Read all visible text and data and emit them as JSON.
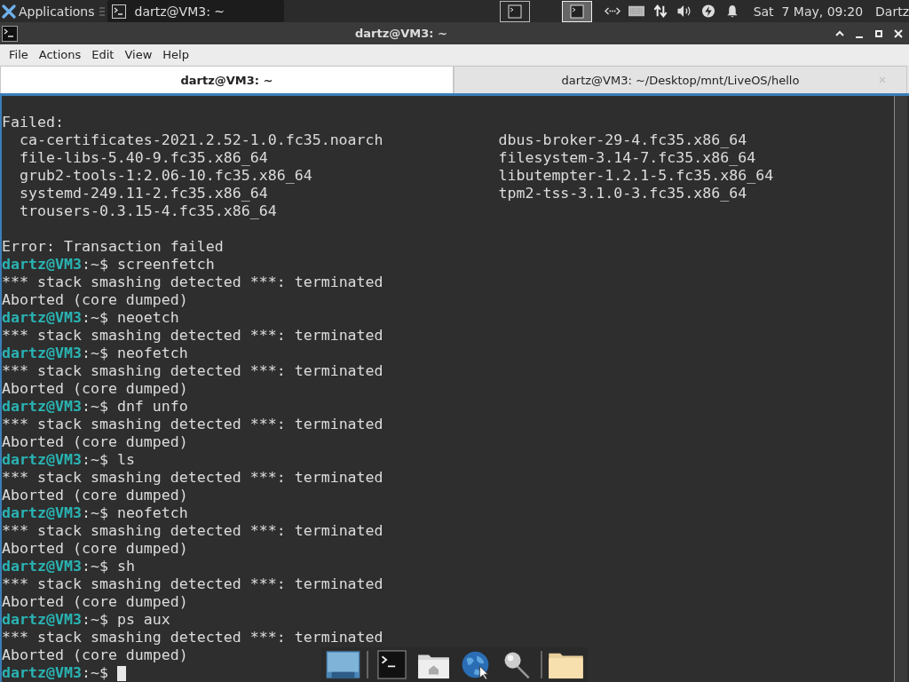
{
  "top_panel": {
    "applications_label": "Applications",
    "task": {
      "title": "dartz@VM3: ~",
      "selected": true
    },
    "workspaces": [
      {
        "selected": false
      },
      {
        "selected": true
      }
    ],
    "clock": "Sat  7 May, 09:20",
    "user": "Dartz"
  },
  "window": {
    "title": "dartz@VM3: ~"
  },
  "menu": [
    "File",
    "Actions",
    "Edit",
    "View",
    "Help"
  ],
  "tabs": [
    {
      "label": "dartz@VM3: ~",
      "selected": true
    },
    {
      "label": "dartz@VM3: ~/Desktop/mnt/LiveOS/hello",
      "selected": false
    }
  ],
  "terminal": {
    "lines": [
      {
        "kind": "output",
        "text": "Failed:"
      },
      {
        "kind": "packages",
        "items": [
          "ca-certificates-2021.2.52-1.0.fc35.noarch",
          "dbus-broker-29-4.fc35.x86_64"
        ]
      },
      {
        "kind": "packages",
        "items": [
          "file-libs-5.40-9.fc35.x86_64",
          "filesystem-3.14-7.fc35.x86_64"
        ]
      },
      {
        "kind": "packages",
        "items": [
          "grub2-tools-1:2.06-10.fc35.x86_64",
          "libutempter-1.2.1-5.fc35.x86_64"
        ]
      },
      {
        "kind": "packages",
        "items": [
          "systemd-249.11-2.fc35.x86_64",
          "tpm2-tss-3.1.0-3.fc35.x86_64"
        ]
      },
      {
        "kind": "packages",
        "items": [
          "trousers-0.3.15-4.fc35.x86_64"
        ]
      },
      {
        "kind": "blank"
      },
      {
        "kind": "output",
        "text": "Error: Transaction failed"
      },
      {
        "kind": "prompt",
        "host": "dartz@VM3",
        "path": ":~$",
        "command": "screenfetch"
      },
      {
        "kind": "output",
        "text": "*** stack smashing detected ***: terminated"
      },
      {
        "kind": "output",
        "text": "Aborted (core dumped)"
      },
      {
        "kind": "prompt",
        "host": "dartz@VM3",
        "path": ":~$",
        "command": "neoetch"
      },
      {
        "kind": "output",
        "text": "*** stack smashing detected ***: terminated"
      },
      {
        "kind": "prompt",
        "host": "dartz@VM3",
        "path": ":~$",
        "command": "neofetch"
      },
      {
        "kind": "output",
        "text": "*** stack smashing detected ***: terminated"
      },
      {
        "kind": "output",
        "text": "Aborted (core dumped)"
      },
      {
        "kind": "prompt",
        "host": "dartz@VM3",
        "path": ":~$",
        "command": "dnf unfo"
      },
      {
        "kind": "output",
        "text": "*** stack smashing detected ***: terminated"
      },
      {
        "kind": "output",
        "text": "Aborted (core dumped)"
      },
      {
        "kind": "prompt",
        "host": "dartz@VM3",
        "path": ":~$",
        "command": "ls"
      },
      {
        "kind": "output",
        "text": "*** stack smashing detected ***: terminated"
      },
      {
        "kind": "output",
        "text": "Aborted (core dumped)"
      },
      {
        "kind": "prompt",
        "host": "dartz@VM3",
        "path": ":~$",
        "command": "neofetch"
      },
      {
        "kind": "output",
        "text": "*** stack smashing detected ***: terminated"
      },
      {
        "kind": "output",
        "text": "Aborted (core dumped)"
      },
      {
        "kind": "prompt",
        "host": "dartz@VM3",
        "path": ":~$",
        "command": "sh"
      },
      {
        "kind": "output",
        "text": "*** stack smashing detected ***: terminated"
      },
      {
        "kind": "output",
        "text": "Aborted (core dumped)"
      },
      {
        "kind": "prompt",
        "host": "dartz@VM3",
        "path": ":~$",
        "command": "ps aux"
      },
      {
        "kind": "output",
        "text": "*** stack smashing detected ***: terminated"
      },
      {
        "kind": "output",
        "text": "Aborted (core dumped)"
      },
      {
        "kind": "prompt",
        "host": "dartz@VM3",
        "path": ":~$",
        "cursor": true
      }
    ]
  }
}
